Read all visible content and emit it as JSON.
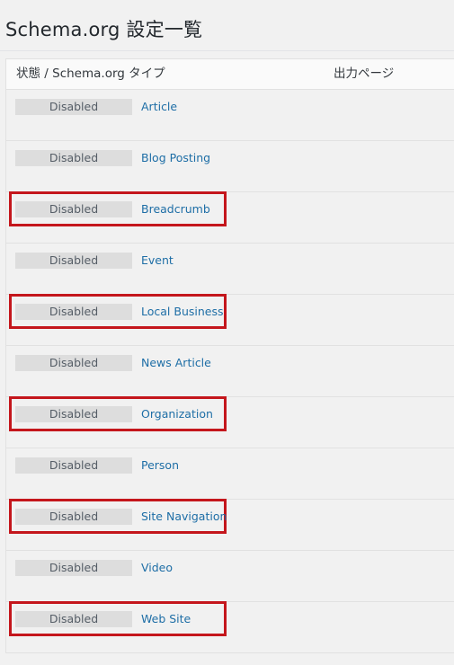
{
  "page": {
    "title": "Schema.org 設定一覧"
  },
  "table": {
    "headers": {
      "type": "状態 / Schema.org タイプ",
      "output": "出力ページ"
    },
    "rows": [
      {
        "status": "Disabled",
        "type": "Article",
        "highlighted": false
      },
      {
        "status": "Disabled",
        "type": "Blog Posting",
        "highlighted": false
      },
      {
        "status": "Disabled",
        "type": "Breadcrumb",
        "highlighted": true
      },
      {
        "status": "Disabled",
        "type": "Event",
        "highlighted": false
      },
      {
        "status": "Disabled",
        "type": "Local Business",
        "highlighted": true
      },
      {
        "status": "Disabled",
        "type": "News Article",
        "highlighted": false
      },
      {
        "status": "Disabled",
        "type": "Organization",
        "highlighted": true
      },
      {
        "status": "Disabled",
        "type": "Person",
        "highlighted": false
      },
      {
        "status": "Disabled",
        "type": "Site Navigation",
        "highlighted": true
      },
      {
        "status": "Disabled",
        "type": "Video",
        "highlighted": false
      },
      {
        "status": "Disabled",
        "type": "Web Site",
        "highlighted": true
      }
    ]
  },
  "colors": {
    "link": "#1e6ea6",
    "highlight_border": "#c4161c",
    "status_bg": "#dddddd"
  }
}
